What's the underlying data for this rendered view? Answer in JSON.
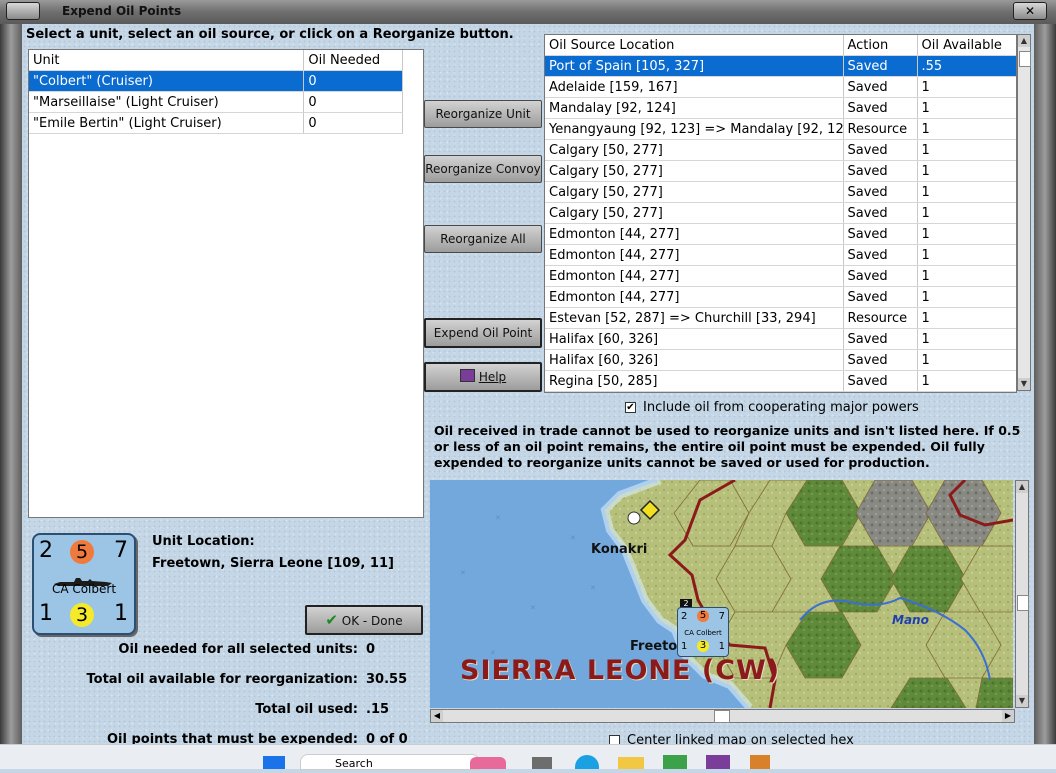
{
  "window": {
    "title": "Expend Oil Points",
    "close_glyph": "✕"
  },
  "instructions": "Select a unit, select an oil source, or click on a Reorganize button.",
  "unit_table": {
    "headers": [
      "Unit",
      "Oil Needed"
    ],
    "rows": [
      {
        "unit": "\"Colbert\" (Cruiser)",
        "oil": "0"
      },
      {
        "unit": "\"Marseillaise\" (Light Cruiser)",
        "oil": "0"
      },
      {
        "unit": "\"Emile Bertin\" (Light Cruiser)",
        "oil": "0"
      }
    ]
  },
  "buttons": {
    "reorganize_unit": "Reorganize Unit",
    "reorganize_convoy": "Reorganize Convoy",
    "reorganize_all": "Reorganize All",
    "expend_oil_point": "Expend Oil Point",
    "help": "Help",
    "ok_done": "OK - Done"
  },
  "oil_table": {
    "headers": [
      "Oil Source Location",
      "Action",
      "Oil Available"
    ],
    "rows": [
      {
        "loc": "Port of Spain [105, 327]",
        "action": "Saved",
        "avail": ".55"
      },
      {
        "loc": "Adelaide [159, 167]",
        "action": "Saved",
        "avail": "1"
      },
      {
        "loc": "Mandalay [92, 124]",
        "action": "Saved",
        "avail": "1"
      },
      {
        "loc": "Yenangyaung [92, 123] => Mandalay [92, 12",
        "action": "Resource",
        "avail": "1"
      },
      {
        "loc": "Calgary [50, 277]",
        "action": "Saved",
        "avail": "1"
      },
      {
        "loc": "Calgary [50, 277]",
        "action": "Saved",
        "avail": "1"
      },
      {
        "loc": "Calgary [50, 277]",
        "action": "Saved",
        "avail": "1"
      },
      {
        "loc": "Calgary [50, 277]",
        "action": "Saved",
        "avail": "1"
      },
      {
        "loc": "Edmonton [44, 277]",
        "action": "Saved",
        "avail": "1"
      },
      {
        "loc": "Edmonton [44, 277]",
        "action": "Saved",
        "avail": "1"
      },
      {
        "loc": "Edmonton [44, 277]",
        "action": "Saved",
        "avail": "1"
      },
      {
        "loc": "Edmonton [44, 277]",
        "action": "Saved",
        "avail": "1"
      },
      {
        "loc": "Estevan [52, 287] => Churchill [33, 294]",
        "action": "Resource",
        "avail": "1"
      },
      {
        "loc": "Halifax [60, 326]",
        "action": "Saved",
        "avail": "1"
      },
      {
        "loc": "Halifax [60, 326]",
        "action": "Saved",
        "avail": "1"
      },
      {
        "loc": "Regina [50, 285]",
        "action": "Saved",
        "avail": "1"
      }
    ]
  },
  "include_coop": {
    "label": "Include oil from cooperating major powers",
    "checked": true
  },
  "note": "Oil received in trade cannot be used to reorganize units and isn't listed here.  If 0.5 or less of an oil point remains, the entire oil point must be expended.   Oil fully expended to reorganize units cannot be saved or used for production.",
  "unit_counter": {
    "attack": "2",
    "strength": "5",
    "move": "7",
    "name": "CA Colbert",
    "def": "1",
    "range": "3",
    "reorg": "1",
    "strength_color": "#f07a3c",
    "range_color": "#f5ea2a"
  },
  "unit_location": {
    "label": "Unit Location:",
    "value": "Freetown, Sierra Leone [109, 11]"
  },
  "summary": {
    "oil_needed_label": "Oil needed for all selected units:",
    "oil_needed": "0",
    "total_avail_label": "Total oil available for reorganization:",
    "total_avail": "30.55",
    "total_used_label": "Total oil used:",
    "total_used": ".15",
    "must_expend_label": "Oil points that must be expended:",
    "must_expend": "0 of 0"
  },
  "map": {
    "labels": {
      "konakri": "Konakri",
      "freetown": "Freeto",
      "country": "SIERRA LEONE (CW)",
      "river": "Mano"
    },
    "mini_counter": {
      "a": "2",
      "s": "5",
      "m": "7",
      "name": "CA Colbert",
      "d": "1",
      "r": "3",
      "o": "1",
      "stack": "2"
    }
  },
  "center_linked": {
    "label": "Center linked map on selected hex",
    "checked": false
  },
  "taskbar": {
    "search": "Search"
  },
  "colors": {
    "selection": "#0a6bd0",
    "panel": "#c5d7e6",
    "border_red": "#8b1a1a"
  }
}
